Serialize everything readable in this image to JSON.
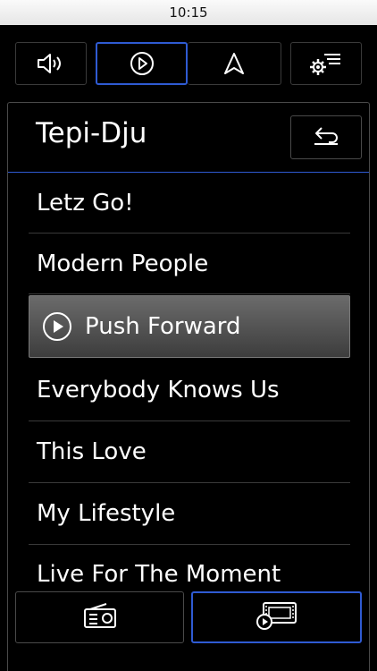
{
  "status_bar": {
    "time": "10:15"
  },
  "top_bar": {
    "items": [
      {
        "name": "volume",
        "icon": "speaker-icon"
      },
      {
        "name": "media",
        "icon": "play-circle-icon",
        "active": true
      },
      {
        "name": "navigation",
        "icon": "navigation-arrow-icon"
      },
      {
        "name": "settings",
        "icon": "gear-menu-icon"
      }
    ]
  },
  "panel": {
    "title": "Tepi-Dju",
    "back_icon": "back-arrow-icon",
    "tracks": [
      {
        "label": "Letz Go!"
      },
      {
        "label": "Modern People"
      },
      {
        "label": "Push Forward",
        "playing": true
      },
      {
        "label": "Everybody Knows Us"
      },
      {
        "label": "This Love"
      },
      {
        "label": "My Lifestyle"
      },
      {
        "label": "Live For The Moment"
      }
    ]
  },
  "bottom_bar": {
    "items": [
      {
        "name": "radio",
        "icon": "radio-icon"
      },
      {
        "name": "media",
        "icon": "media-player-icon",
        "active": true
      }
    ]
  },
  "colors": {
    "accent": "#2f5bd3",
    "background": "#000000",
    "border": "#4a4a4a"
  }
}
